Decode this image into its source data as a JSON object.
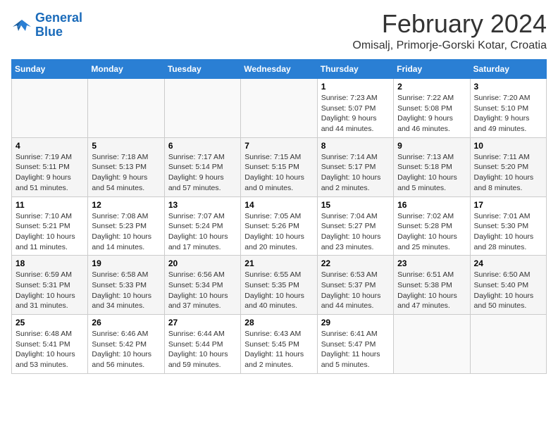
{
  "header": {
    "logo_line1": "General",
    "logo_line2": "Blue",
    "month_year": "February 2024",
    "location": "Omisalj, Primorje-Gorski Kotar, Croatia"
  },
  "columns": [
    "Sunday",
    "Monday",
    "Tuesday",
    "Wednesday",
    "Thursday",
    "Friday",
    "Saturday"
  ],
  "weeks": [
    [
      {
        "day": "",
        "info": ""
      },
      {
        "day": "",
        "info": ""
      },
      {
        "day": "",
        "info": ""
      },
      {
        "day": "",
        "info": ""
      },
      {
        "day": "1",
        "info": "Sunrise: 7:23 AM\nSunset: 5:07 PM\nDaylight: 9 hours and 44 minutes."
      },
      {
        "day": "2",
        "info": "Sunrise: 7:22 AM\nSunset: 5:08 PM\nDaylight: 9 hours and 46 minutes."
      },
      {
        "day": "3",
        "info": "Sunrise: 7:20 AM\nSunset: 5:10 PM\nDaylight: 9 hours and 49 minutes."
      }
    ],
    [
      {
        "day": "4",
        "info": "Sunrise: 7:19 AM\nSunset: 5:11 PM\nDaylight: 9 hours and 51 minutes."
      },
      {
        "day": "5",
        "info": "Sunrise: 7:18 AM\nSunset: 5:13 PM\nDaylight: 9 hours and 54 minutes."
      },
      {
        "day": "6",
        "info": "Sunrise: 7:17 AM\nSunset: 5:14 PM\nDaylight: 9 hours and 57 minutes."
      },
      {
        "day": "7",
        "info": "Sunrise: 7:15 AM\nSunset: 5:15 PM\nDaylight: 10 hours and 0 minutes."
      },
      {
        "day": "8",
        "info": "Sunrise: 7:14 AM\nSunset: 5:17 PM\nDaylight: 10 hours and 2 minutes."
      },
      {
        "day": "9",
        "info": "Sunrise: 7:13 AM\nSunset: 5:18 PM\nDaylight: 10 hours and 5 minutes."
      },
      {
        "day": "10",
        "info": "Sunrise: 7:11 AM\nSunset: 5:20 PM\nDaylight: 10 hours and 8 minutes."
      }
    ],
    [
      {
        "day": "11",
        "info": "Sunrise: 7:10 AM\nSunset: 5:21 PM\nDaylight: 10 hours and 11 minutes."
      },
      {
        "day": "12",
        "info": "Sunrise: 7:08 AM\nSunset: 5:23 PM\nDaylight: 10 hours and 14 minutes."
      },
      {
        "day": "13",
        "info": "Sunrise: 7:07 AM\nSunset: 5:24 PM\nDaylight: 10 hours and 17 minutes."
      },
      {
        "day": "14",
        "info": "Sunrise: 7:05 AM\nSunset: 5:26 PM\nDaylight: 10 hours and 20 minutes."
      },
      {
        "day": "15",
        "info": "Sunrise: 7:04 AM\nSunset: 5:27 PM\nDaylight: 10 hours and 23 minutes."
      },
      {
        "day": "16",
        "info": "Sunrise: 7:02 AM\nSunset: 5:28 PM\nDaylight: 10 hours and 25 minutes."
      },
      {
        "day": "17",
        "info": "Sunrise: 7:01 AM\nSunset: 5:30 PM\nDaylight: 10 hours and 28 minutes."
      }
    ],
    [
      {
        "day": "18",
        "info": "Sunrise: 6:59 AM\nSunset: 5:31 PM\nDaylight: 10 hours and 31 minutes."
      },
      {
        "day": "19",
        "info": "Sunrise: 6:58 AM\nSunset: 5:33 PM\nDaylight: 10 hours and 34 minutes."
      },
      {
        "day": "20",
        "info": "Sunrise: 6:56 AM\nSunset: 5:34 PM\nDaylight: 10 hours and 37 minutes."
      },
      {
        "day": "21",
        "info": "Sunrise: 6:55 AM\nSunset: 5:35 PM\nDaylight: 10 hours and 40 minutes."
      },
      {
        "day": "22",
        "info": "Sunrise: 6:53 AM\nSunset: 5:37 PM\nDaylight: 10 hours and 44 minutes."
      },
      {
        "day": "23",
        "info": "Sunrise: 6:51 AM\nSunset: 5:38 PM\nDaylight: 10 hours and 47 minutes."
      },
      {
        "day": "24",
        "info": "Sunrise: 6:50 AM\nSunset: 5:40 PM\nDaylight: 10 hours and 50 minutes."
      }
    ],
    [
      {
        "day": "25",
        "info": "Sunrise: 6:48 AM\nSunset: 5:41 PM\nDaylight: 10 hours and 53 minutes."
      },
      {
        "day": "26",
        "info": "Sunrise: 6:46 AM\nSunset: 5:42 PM\nDaylight: 10 hours and 56 minutes."
      },
      {
        "day": "27",
        "info": "Sunrise: 6:44 AM\nSunset: 5:44 PM\nDaylight: 10 hours and 59 minutes."
      },
      {
        "day": "28",
        "info": "Sunrise: 6:43 AM\nSunset: 5:45 PM\nDaylight: 11 hours and 2 minutes."
      },
      {
        "day": "29",
        "info": "Sunrise: 6:41 AM\nSunset: 5:47 PM\nDaylight: 11 hours and 5 minutes."
      },
      {
        "day": "",
        "info": ""
      },
      {
        "day": "",
        "info": ""
      }
    ]
  ]
}
